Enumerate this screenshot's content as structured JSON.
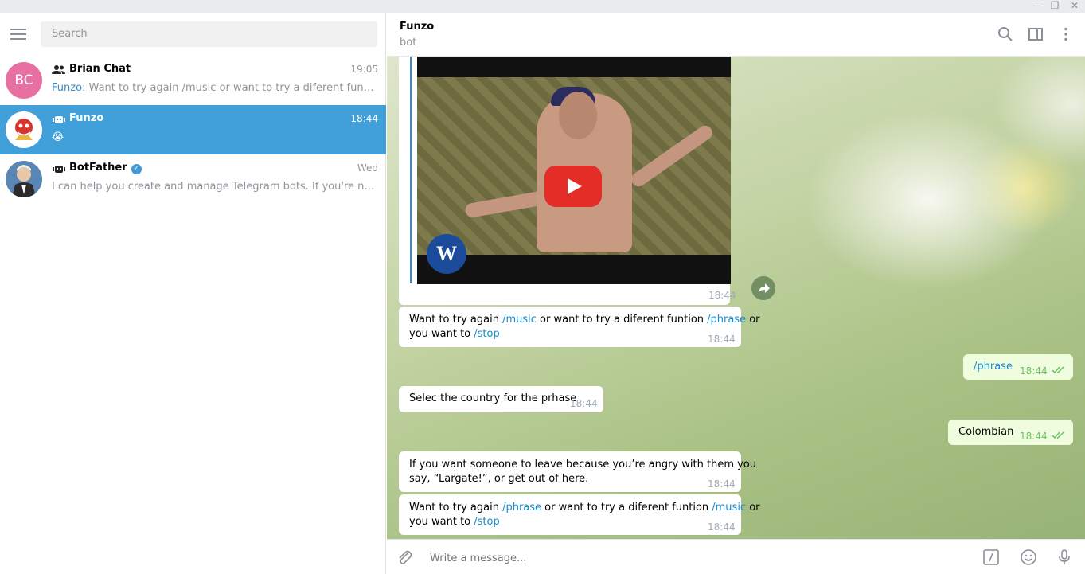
{
  "sidebar": {
    "search_placeholder": "Search",
    "chats": [
      {
        "avatar_text": "BC",
        "name": "Brian Chat",
        "time": "19:05",
        "preview_from": "Funzo",
        "preview": ": Want to try again /music or want to try a diferent funtion /phrase or you want to /stop"
      },
      {
        "name": "Funzo",
        "time": "18:44",
        "preview": "😭"
      },
      {
        "name": "BotFather",
        "time": "Wed",
        "preview": "I can help you create and manage Telegram bots. If you're new to the Bot API, please see the manual."
      }
    ]
  },
  "header": {
    "title": "Funzo",
    "subtitle": "bot"
  },
  "messages": {
    "m0_time": "18:44",
    "m1": {
      "a": "Want to try again ",
      "cmd1": "/music",
      "b": " or want to try a diferent funtion ",
      "cmd2": "/phrase",
      "c": " or",
      "d": "you want to ",
      "cmd3": "/stop",
      "time": "18:44"
    },
    "m2": {
      "text": "/phrase",
      "time": "18:44"
    },
    "m3": {
      "text": "Selec the country for the prhase",
      "time": "18:44"
    },
    "m4": {
      "text": "Colombian",
      "time": "18:44"
    },
    "m5": {
      "line1": "If you want someone to leave because you’re angry with them you",
      "line2": "say, “Largate!”, or get out of here.",
      "time": "18:44"
    },
    "m6": {
      "a": "Want to try again ",
      "cmd1": "/phrase",
      "b": " or want to try a diferent funtion ",
      "cmd2": "/music",
      "c": " or",
      "d": "you want to ",
      "cmd3": "/stop",
      "time": "18:44"
    }
  },
  "composer": {
    "placeholder": "Write a message..."
  },
  "colors": {
    "accent": "#419fd9",
    "link": "#168acd",
    "outgoing_bubble": "#effdde"
  }
}
